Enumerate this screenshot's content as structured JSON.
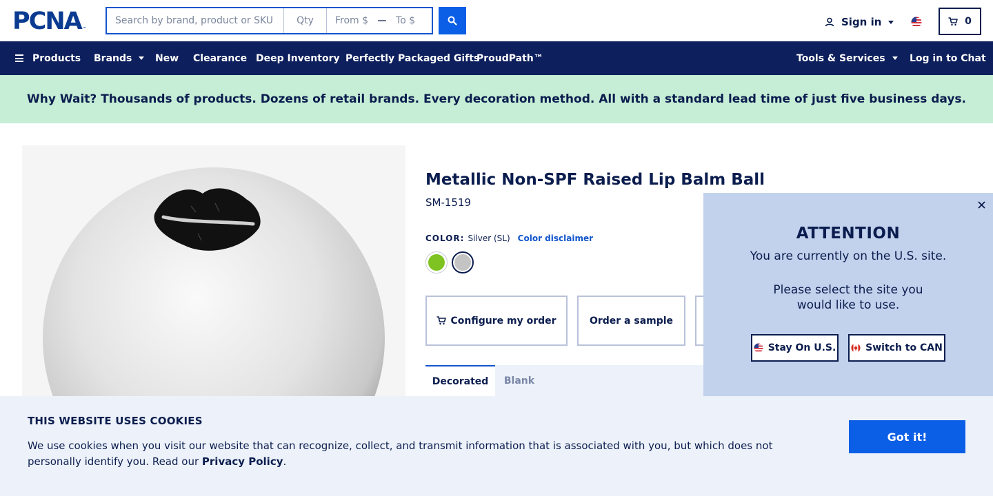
{
  "header": {
    "logo_text": "PCNA",
    "logo_tm": "™",
    "search_placeholder": "Search by brand, product or SKU",
    "qty_placeholder": "Qty",
    "price_from_placeholder": "From $",
    "price_to_placeholder": "To $",
    "sign_in_label": "Sign in",
    "cart_count": "0"
  },
  "nav": {
    "items": [
      {
        "label": "Products"
      },
      {
        "label": "Brands"
      },
      {
        "label": "New"
      },
      {
        "label": "Clearance"
      },
      {
        "label": "Deep Inventory"
      },
      {
        "label": "Perfectly Packaged Gifts"
      },
      {
        "label": "ProudPath™"
      }
    ],
    "right_items": [
      {
        "label": "Tools & Services"
      },
      {
        "label": "Log in to Chat"
      }
    ]
  },
  "promo": {
    "text": "Why Wait? Thousands of products. Dozens of retail brands. Every decoration method. All with a standard lead time of just five business days."
  },
  "product": {
    "title": "Metallic Non-SPF Raised Lip Balm Ball",
    "sku": "SM-1519",
    "color_label": "COLOR:",
    "color_value": "Silver (SL)",
    "color_disclaimer": "Color disclaimer",
    "swatches": [
      {
        "name": "Lime Green",
        "color": "#7ec321"
      },
      {
        "name": "Silver",
        "color": "#c4c4c4",
        "selected": true
      }
    ],
    "actions": {
      "configure": "Configure my order",
      "sample": "Order a sample"
    },
    "tabs": [
      {
        "label": "Decorated",
        "active": true
      },
      {
        "label": "Blank",
        "active": false
      }
    ]
  },
  "site_popup": {
    "title": "ATTENTION",
    "line1": "You are currently on the U.S. site.",
    "line2": "Please select the site you",
    "line3": "would like to use.",
    "stay_label": "Stay On U.S.",
    "switch_label": "Switch to CAN"
  },
  "cookie": {
    "title": "THIS WEBSITE USES COOKIES",
    "text": "We use cookies when you visit our website that can recognize, collect, and transmit information that is associated with you, but which does not personally identify you. Read our ",
    "link": "Privacy Policy",
    "end": ".",
    "button": "Got it!"
  },
  "colors": {
    "navy": "#0d1f5c",
    "brand_blue": "#0b5fe6",
    "promo_bg": "#c6eed6",
    "popup_bg": "#c2d1ec",
    "cookie_bg": "#edf2fa"
  }
}
